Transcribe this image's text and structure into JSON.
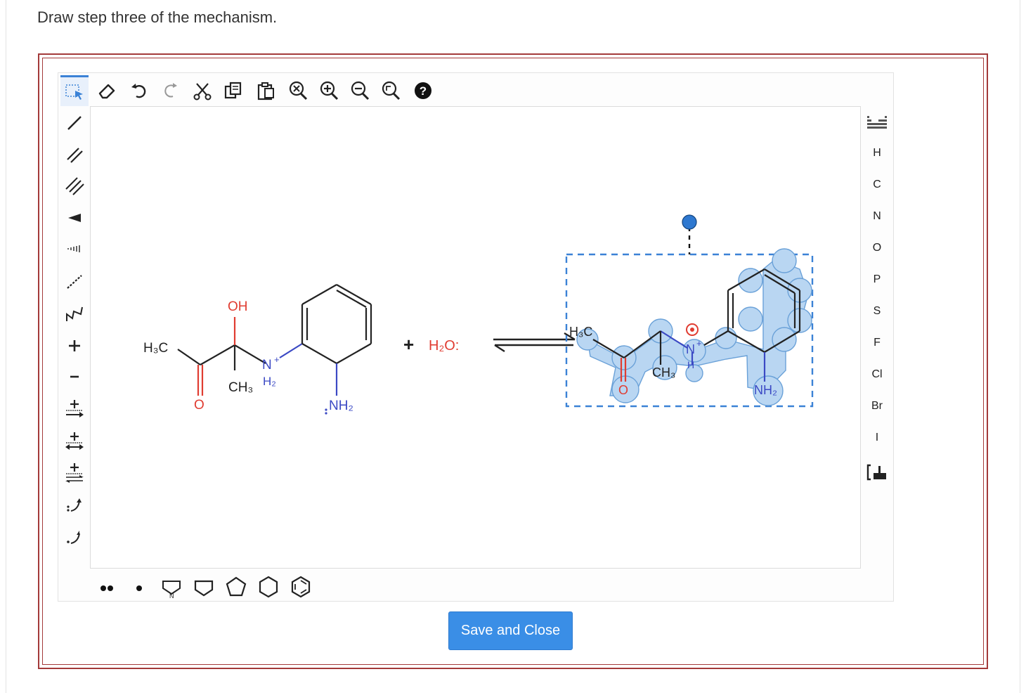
{
  "question": {
    "text": "Draw step three of the mechanism."
  },
  "toolbar_top": {
    "items": [
      "select-tool",
      "eraser-icon",
      "undo-icon",
      "redo-icon",
      "cut-icon",
      "copy-icon",
      "paste-icon",
      "zoom-reset-icon",
      "zoom-in-icon",
      "zoom-out-icon",
      "zoom-fit-icon",
      "help-icon"
    ]
  },
  "left_toolbar": {
    "items": [
      "single-bond-icon",
      "double-bond-icon",
      "triple-bond-icon",
      "wedge-bond-icon",
      "hash-bond-icon",
      "dashed-bond-icon",
      "chain-icon",
      "positive-charge-icon",
      "negative-charge-icon",
      "reaction-arrow-icon",
      "resonance-arrow-icon",
      "equilibrium-arrow-icon",
      "electron-pair-arrow-icon",
      "single-electron-arrow-icon"
    ]
  },
  "right_toolbar": {
    "elements": [
      "H",
      "C",
      "N",
      "O",
      "P",
      "S",
      "F",
      "Cl",
      "Br",
      "I"
    ]
  },
  "bottom_toolbar": {
    "items": [
      "lone-pair-icon",
      "radical-icon",
      "pyrrole-ring-icon",
      "cyclobutane-icon",
      "cyclopentane-icon",
      "cyclohexane-icon",
      "benzene-icon"
    ]
  },
  "molecule_left": {
    "h3c": "H₃C",
    "oh": "OH",
    "ch3": "CH₃",
    "n_plus": "N",
    "plus_charge": "+",
    "h2": "H₂",
    "o": "O",
    "nh2": "NH₂"
  },
  "reagent": {
    "plus": "+",
    "water": "H₂O:"
  },
  "molecule_right": {
    "h3c": "H₃C",
    "o": "O",
    "ch3": "CH₃",
    "n_plus": "N",
    "plus_charge": "+",
    "h": "H",
    "nh2": "NH₂"
  },
  "colors": {
    "accent": "#3a8ee6",
    "oxygen": "#e03c31",
    "nitrogen": "#3b49c4",
    "highlight": "#b9d6f2",
    "frame": "#a33a3a"
  },
  "save_button": {
    "label": "Save and Close"
  }
}
